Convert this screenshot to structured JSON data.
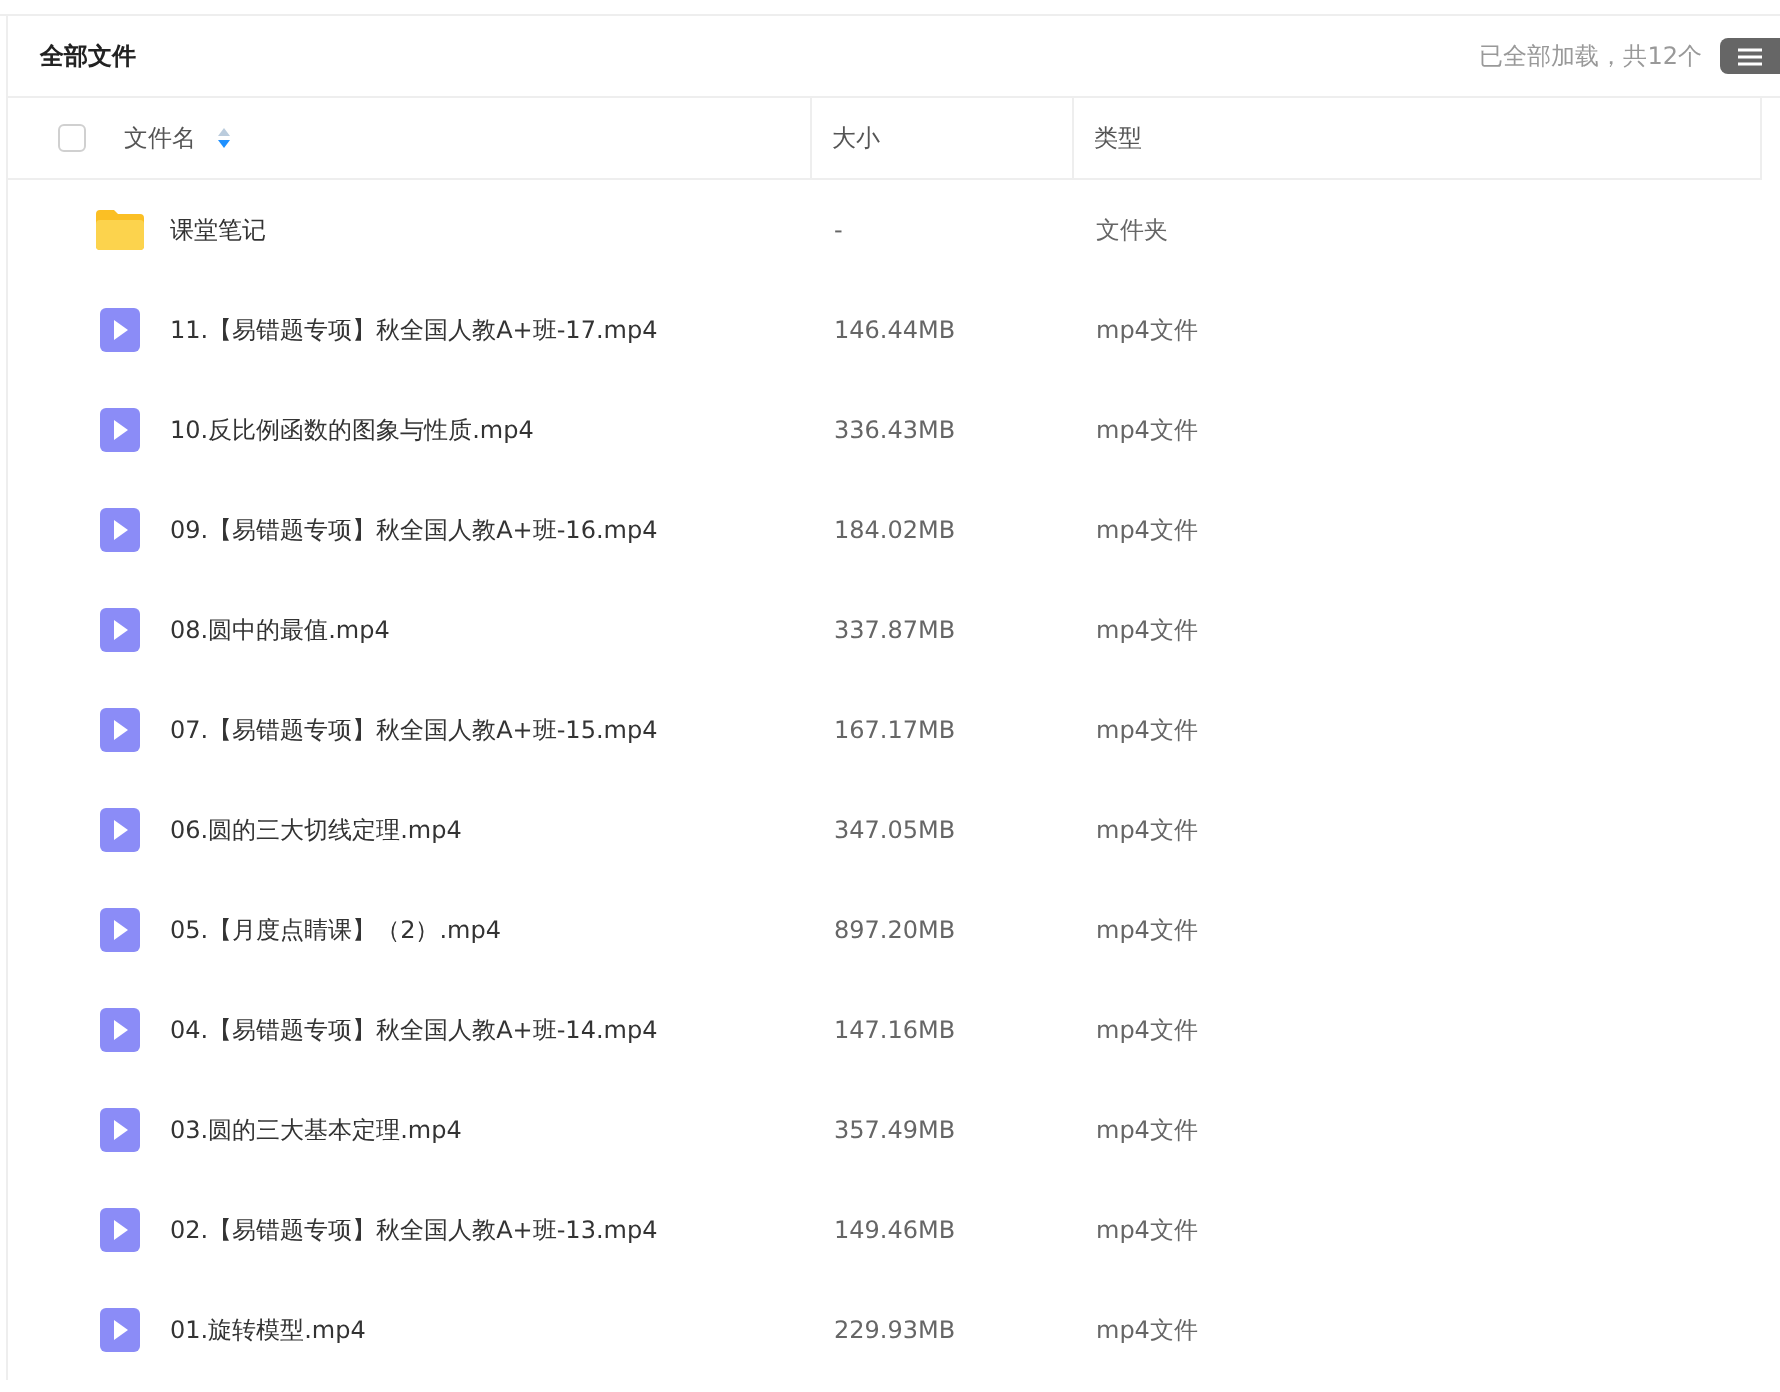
{
  "header": {
    "title": "全部文件",
    "status": "已全部加载，共12个"
  },
  "table": {
    "columns": [
      "文件名",
      "大小",
      "类型"
    ],
    "select_all": {
      "checked": false
    },
    "rows": [
      {
        "kind": "folder",
        "name": "课堂笔记",
        "size": "-",
        "type": "文件夹"
      },
      {
        "kind": "video",
        "name": "11.【易错题专项】秋全国人教A+班-17.mp4",
        "size": "146.44MB",
        "type": "mp4文件"
      },
      {
        "kind": "video",
        "name": "10.反比例函数的图象与性质.mp4",
        "size": "336.43MB",
        "type": "mp4文件"
      },
      {
        "kind": "video",
        "name": "09.【易错题专项】秋全国人教A+班-16.mp4",
        "size": "184.02MB",
        "type": "mp4文件"
      },
      {
        "kind": "video",
        "name": "08.圆中的最值.mp4",
        "size": "337.87MB",
        "type": "mp4文件"
      },
      {
        "kind": "video",
        "name": "07.【易错题专项】秋全国人教A+班-15.mp4",
        "size": "167.17MB",
        "type": "mp4文件"
      },
      {
        "kind": "video",
        "name": "06.圆的三大切线定理.mp4",
        "size": "347.05MB",
        "type": "mp4文件"
      },
      {
        "kind": "video",
        "name": "05.【月度点睛课】（2）.mp4",
        "size": "897.20MB",
        "type": "mp4文件"
      },
      {
        "kind": "video",
        "name": "04.【易错题专项】秋全国人教A+班-14.mp4",
        "size": "147.16MB",
        "type": "mp4文件"
      },
      {
        "kind": "video",
        "name": "03.圆的三大基本定理.mp4",
        "size": "357.49MB",
        "type": "mp4文件"
      },
      {
        "kind": "video",
        "name": "02.【易错题专项】秋全国人教A+班-13.mp4",
        "size": "149.46MB",
        "type": "mp4文件"
      },
      {
        "kind": "video",
        "name": "01.旋转模型.mp4",
        "size": "229.93MB",
        "type": "mp4文件"
      }
    ]
  }
}
